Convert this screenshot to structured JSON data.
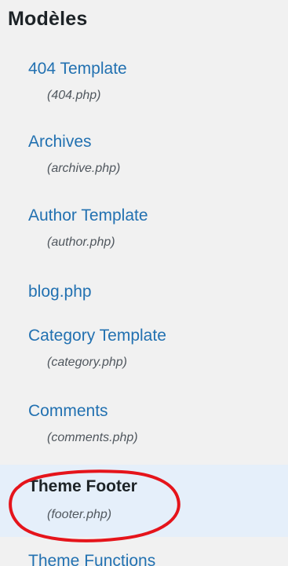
{
  "panel": {
    "heading": "Modèles"
  },
  "templates": [
    {
      "label": "404 Template",
      "file": "(404.php)"
    },
    {
      "label": "Archives",
      "file": "(archive.php)"
    },
    {
      "label": "Author Template",
      "file": "(author.php)"
    },
    {
      "label": "blog.php",
      "file": ""
    },
    {
      "label": "Category Template",
      "file": "(category.php)"
    },
    {
      "label": "Comments",
      "file": "(comments.php)"
    },
    {
      "label": "Theme Footer",
      "file": "(footer.php)"
    },
    {
      "label": "Theme Functions",
      "file": ""
    }
  ],
  "colors": {
    "link": "#2271b1",
    "active_background": "#e5effa",
    "annotation": "#e5141b"
  }
}
